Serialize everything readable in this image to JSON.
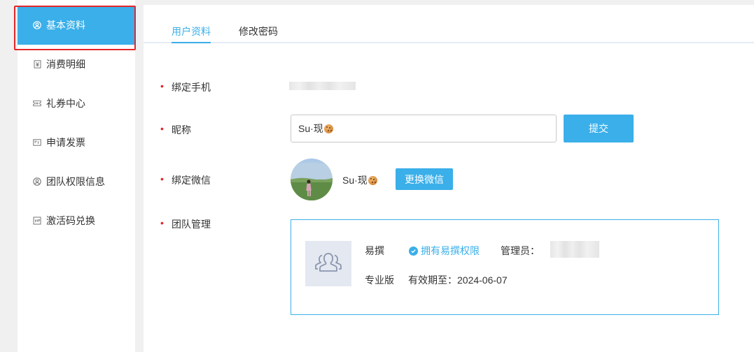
{
  "sidebar": {
    "items": [
      {
        "label": "基本资料",
        "icon": "user-circle-icon",
        "active": true
      },
      {
        "label": "消费明细",
        "icon": "receipt-icon"
      },
      {
        "label": "礼券中心",
        "icon": "ticket-icon"
      },
      {
        "label": "申请发票",
        "icon": "invoice-icon"
      },
      {
        "label": "团队权限信息",
        "icon": "user-circle-icon"
      },
      {
        "label": "激活码兑换",
        "icon": "vip-icon"
      }
    ]
  },
  "tabs": [
    {
      "label": "用户资料",
      "active": true
    },
    {
      "label": "修改密码"
    }
  ],
  "form": {
    "phone_label": "绑定手机",
    "nickname_label": "昵称",
    "nickname_value": "Su·现",
    "submit_label": "提交",
    "wechat_label": "绑定微信",
    "wechat_name": "Su·现",
    "change_wechat_label": "更换微信",
    "team_label": "团队管理"
  },
  "team": {
    "name": "易撰",
    "permission": "拥有易撰权限",
    "admin_label": "管理员：",
    "edition": "专业版",
    "expiry": "有效期至：2024-06-07"
  },
  "colors": {
    "accent": "#3aafe9",
    "required": "#e4262a",
    "highlight": "#e4262a"
  }
}
